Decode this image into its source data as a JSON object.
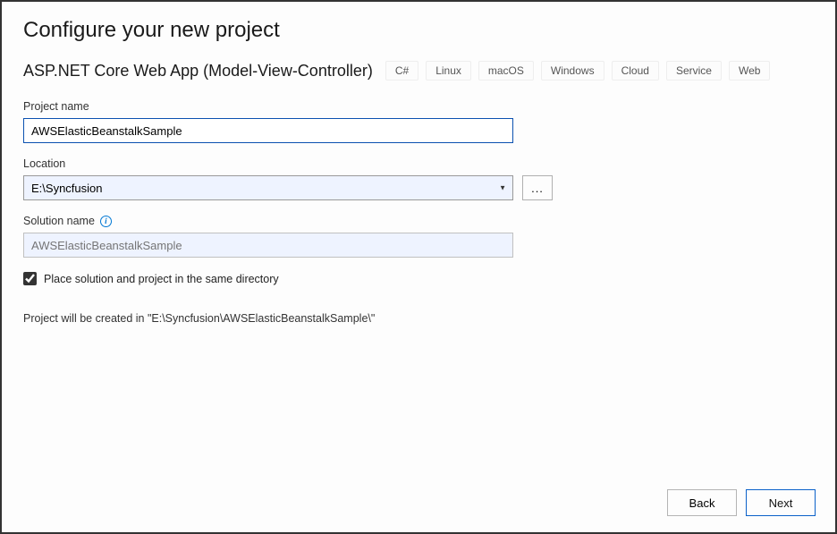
{
  "title": "Configure your new project",
  "subtitle": "ASP.NET Core Web App (Model-View-Controller)",
  "tags": [
    "C#",
    "Linux",
    "macOS",
    "Windows",
    "Cloud",
    "Service",
    "Web"
  ],
  "fields": {
    "projectName": {
      "label": "Project name",
      "value": "AWSElasticBeanstalkSample"
    },
    "location": {
      "label": "Location",
      "value": "E:\\Syncfusion",
      "browseLabel": "..."
    },
    "solutionName": {
      "label": "Solution name",
      "placeholder": "AWSElasticBeanstalkSample"
    }
  },
  "checkbox": {
    "label": "Place solution and project in the same directory",
    "checked": true
  },
  "status": "Project will be created in \"E:\\Syncfusion\\AWSElasticBeanstalkSample\\\"",
  "buttons": {
    "back": "Back",
    "next": "Next"
  }
}
